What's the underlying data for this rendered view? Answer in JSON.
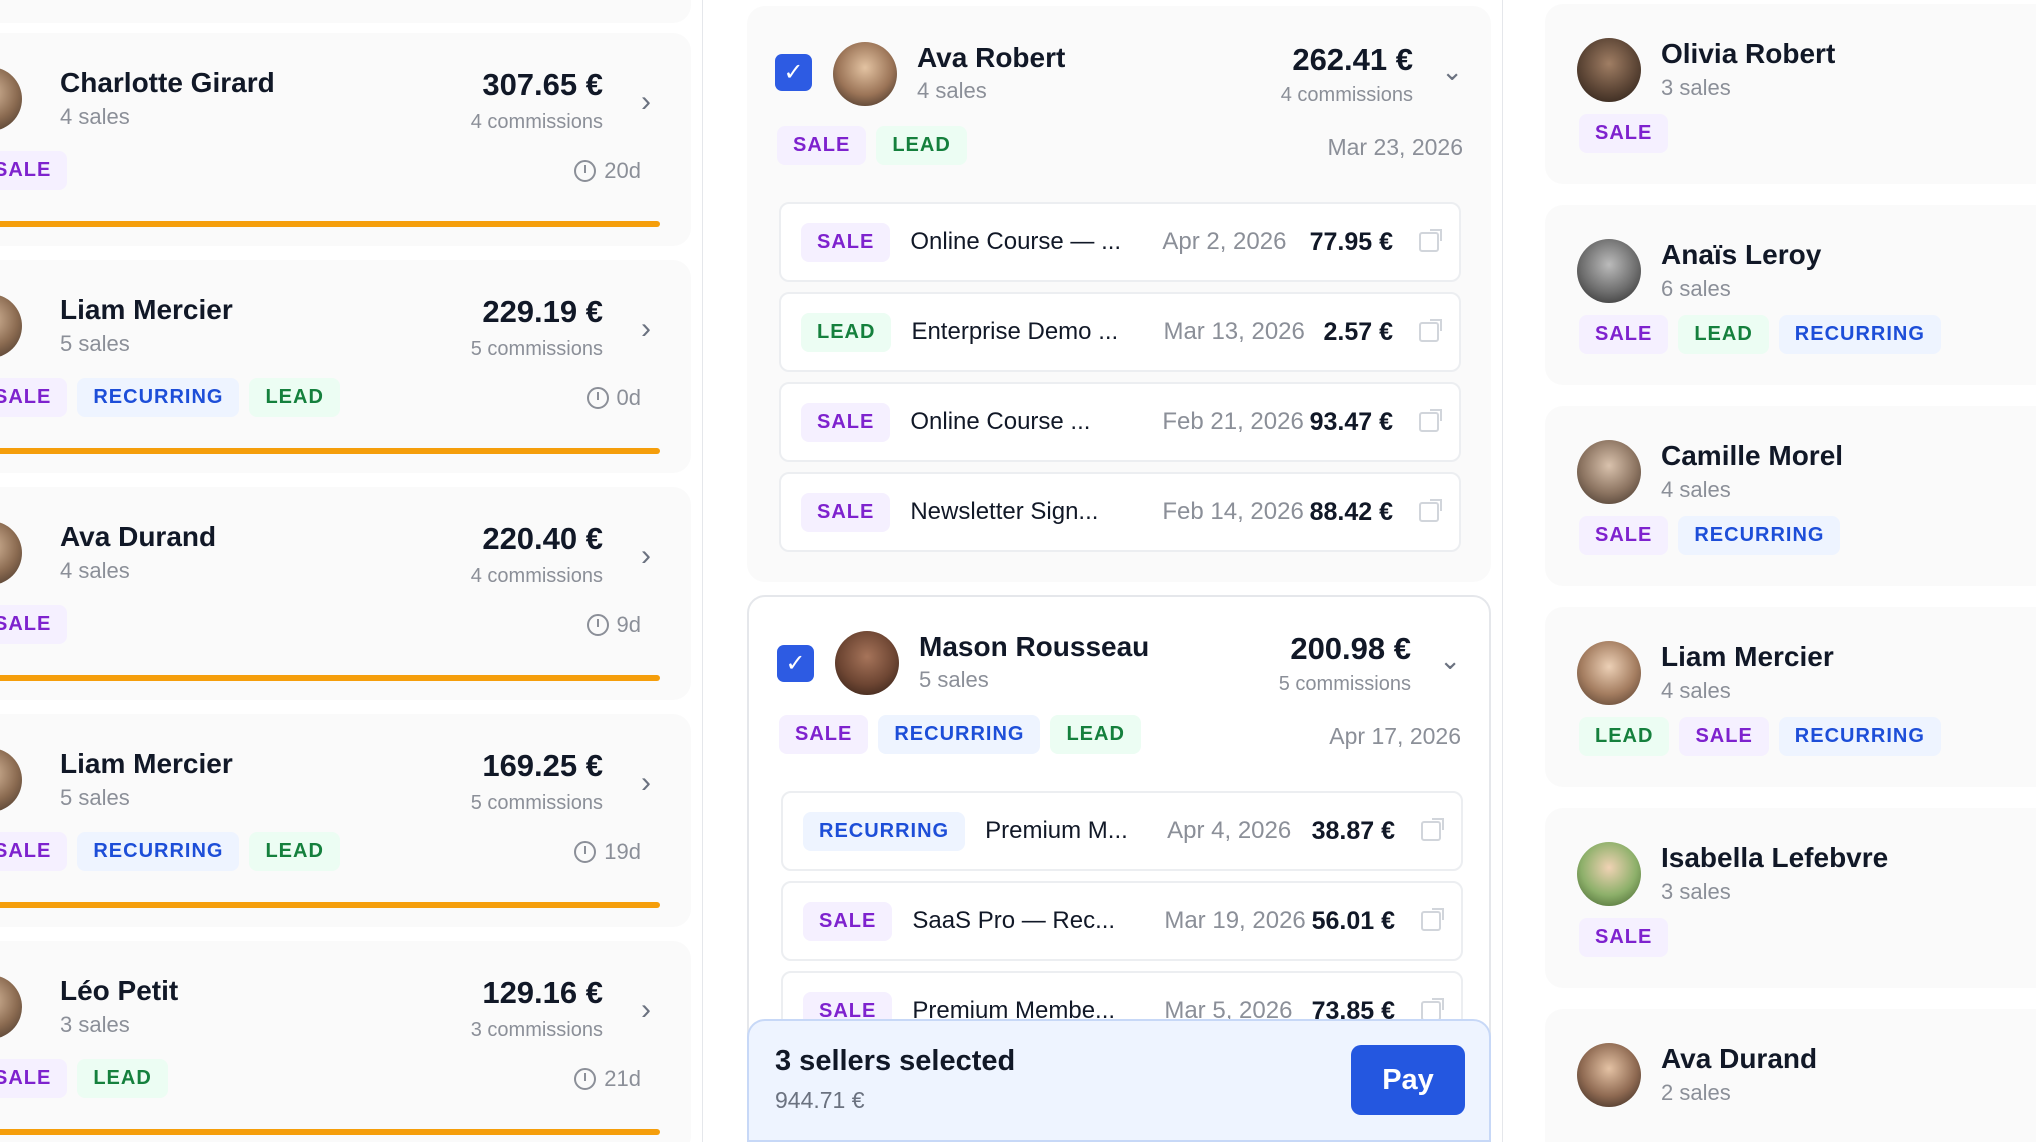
{
  "left_cards": [
    {
      "name": "Charlotte Girard",
      "sales": "4 sales",
      "amount": "307.65 €",
      "commissions": "4 commissions",
      "tags": [
        "SALE"
      ],
      "age": "20d"
    },
    {
      "name": "Liam Mercier",
      "sales": "5 sales",
      "amount": "229.19 €",
      "commissions": "5 commissions",
      "tags": [
        "SALE",
        "RECURRING",
        "LEAD"
      ],
      "age": "0d"
    },
    {
      "name": "Ava Durand",
      "sales": "4 sales",
      "amount": "220.40 €",
      "commissions": "4 commissions",
      "tags": [
        "SALE"
      ],
      "age": "9d"
    },
    {
      "name": "Liam Mercier",
      "sales": "5 sales",
      "amount": "169.25 €",
      "commissions": "5 commissions",
      "tags": [
        "SALE",
        "RECURRING",
        "LEAD"
      ],
      "age": "19d"
    },
    {
      "name": "Léo Petit",
      "sales": "3 sales",
      "amount": "129.16 €",
      "commissions": "3 commissions",
      "tags": [
        "SALE",
        "LEAD"
      ],
      "age": "21d"
    }
  ],
  "middle_groups": [
    {
      "name": "Ava Robert",
      "sales": "4 sales",
      "amount": "262.41 €",
      "commissions": "4 commissions",
      "tags": [
        "SALE",
        "LEAD"
      ],
      "date": "Mar 23, 2026",
      "checked": true,
      "rows": [
        {
          "tag": "SALE",
          "product": "Online Course — ...",
          "date": "Apr 2, 2026",
          "amount": "77.95 €"
        },
        {
          "tag": "LEAD",
          "product": "Enterprise Demo ...",
          "date": "Mar 13, 2026",
          "amount": "2.57 €"
        },
        {
          "tag": "SALE",
          "product": "Online Course ...",
          "date": "Feb 21, 2026",
          "amount": "93.47 €"
        },
        {
          "tag": "SALE",
          "product": "Newsletter Sign...",
          "date": "Feb 14, 2026",
          "amount": "88.42 €"
        }
      ]
    },
    {
      "name": "Mason Rousseau",
      "sales": "5 sales",
      "amount": "200.98 €",
      "commissions": "5 commissions",
      "tags": [
        "SALE",
        "RECURRING",
        "LEAD"
      ],
      "date": "Apr 17, 2026",
      "checked": true,
      "rows": [
        {
          "tag": "RECURRING",
          "product": "Premium M...",
          "date": "Apr 4, 2026",
          "amount": "38.87 €"
        },
        {
          "tag": "SALE",
          "product": "SaaS Pro — Rec...",
          "date": "Mar 19, 2026",
          "amount": "56.01 €"
        },
        {
          "tag": "SALE",
          "product": "Premium Membe...",
          "date": "Mar 5, 2026",
          "amount": "73.85 €"
        }
      ]
    }
  ],
  "paybar": {
    "title": "3 sellers selected",
    "amount": "944.71 €",
    "button": "Pay"
  },
  "right_cards": [
    {
      "name": "Olivia Robert",
      "sales": "3 sales",
      "tags": [
        "SALE"
      ]
    },
    {
      "name": "Anaïs Leroy",
      "sales": "6 sales",
      "tags": [
        "SALE",
        "LEAD",
        "RECURRING"
      ]
    },
    {
      "name": "Camille Morel",
      "sales": "4 sales",
      "tags": [
        "SALE",
        "RECURRING"
      ]
    },
    {
      "name": "Liam Mercier",
      "sales": "4 sales",
      "tags": [
        "LEAD",
        "SALE",
        "RECURRING"
      ]
    },
    {
      "name": "Isabella Lefebvre",
      "sales": "3 sales",
      "tags": [
        "SALE"
      ]
    },
    {
      "name": "Ava Durand",
      "sales": "2 sales",
      "tags": []
    }
  ],
  "colors": {
    "accent": "#2457e0",
    "progress": "#f59e0b",
    "sale": "#7e22ce",
    "recurring": "#1d4ed8",
    "lead": "#15803d"
  },
  "icons": {
    "chevron_right": "chevron-right-icon",
    "chevron_down": "chevron-down-icon",
    "clock": "clock-icon",
    "external_link": "external-link-icon",
    "check": "checkbox-checked-icon"
  }
}
